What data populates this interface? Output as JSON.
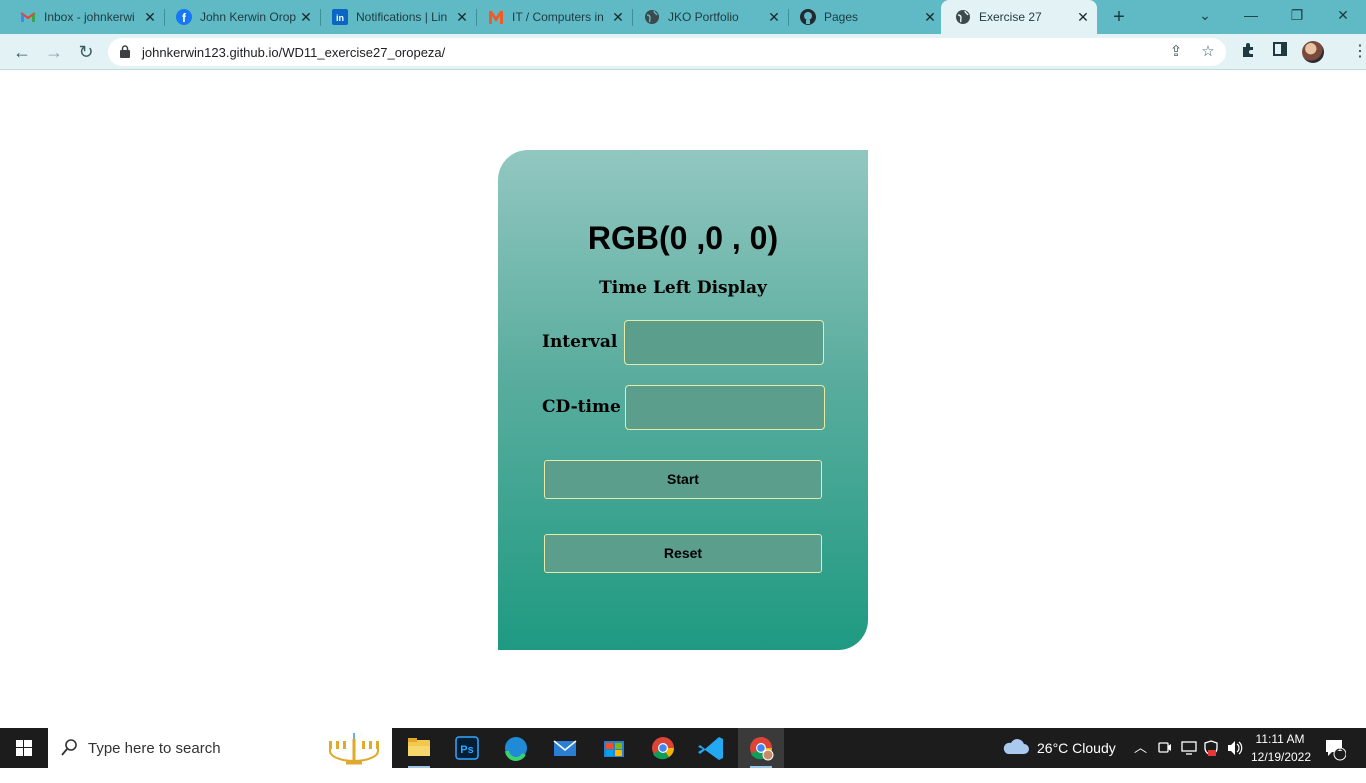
{
  "browser": {
    "tabs": [
      {
        "title": "Inbox - johnkerwi",
        "icon": "gmail-icon"
      },
      {
        "title": "John Kerwin Orop",
        "icon": "facebook-icon"
      },
      {
        "title": "Notifications | Lin",
        "icon": "linkedin-icon"
      },
      {
        "title": "IT / Computers in",
        "icon": "shop-m-icon"
      },
      {
        "title": "JKO Portfolio",
        "icon": "globe-icon"
      },
      {
        "title": "Pages",
        "icon": "github-icon"
      },
      {
        "title": "Exercise 27",
        "icon": "globe-icon",
        "active": true
      }
    ],
    "url": "johnkerwin123.github.io/WD11_exercise27_oropeza/"
  },
  "page": {
    "rgb_display": "RGB(0 ,0 , 0)",
    "time_left_label": "Time Left Display",
    "interval_label": "Interval :",
    "interval_value": "",
    "cdtime_label": "CD-time :",
    "cdtime_value": "",
    "start_label": "Start",
    "reset_label": "Reset"
  },
  "taskbar": {
    "search_placeholder": "Type here to search",
    "weather": "26°C  Cloudy",
    "time": "11:11 AM",
    "date": "12/19/2022",
    "notification_count": "1"
  },
  "colors": {
    "tabstrip": "#5fbac6",
    "toolbar": "#e3f3f5",
    "card_top": "#92c7c1",
    "card_bottom": "#1f9a82",
    "field_bg": "#5a9e8b",
    "field_border": "#e6eba8"
  }
}
